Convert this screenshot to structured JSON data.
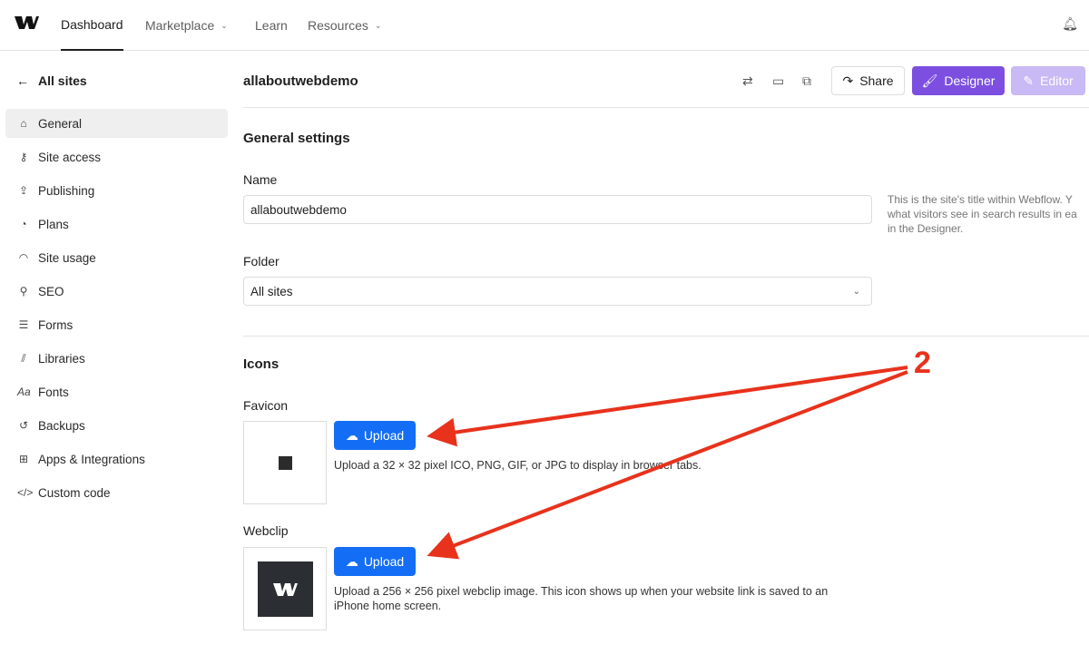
{
  "topnav": {
    "items": [
      {
        "label": "Dashboard",
        "active": true
      },
      {
        "label": "Marketplace",
        "dropdown": true
      },
      {
        "label": "Learn"
      },
      {
        "label": "Resources",
        "dropdown": true
      }
    ],
    "bell_icon": "bell-icon"
  },
  "sidebar": {
    "back_label": "All sites",
    "items": [
      {
        "label": "General",
        "icon": "home-icon",
        "selected": true
      },
      {
        "label": "Site access",
        "icon": "key-icon"
      },
      {
        "label": "Publishing",
        "icon": "publish-icon"
      },
      {
        "label": "Plans",
        "icon": "plans-icon"
      },
      {
        "label": "Site usage",
        "icon": "gauge-icon"
      },
      {
        "label": "SEO",
        "icon": "search-icon"
      },
      {
        "label": "Forms",
        "icon": "forms-icon"
      },
      {
        "label": "Libraries",
        "icon": "libraries-icon"
      },
      {
        "label": "Fonts",
        "icon": "fonts-icon"
      },
      {
        "label": "Backups",
        "icon": "backup-icon"
      },
      {
        "label": "Apps & Integrations",
        "icon": "apps-icon"
      },
      {
        "label": "Custom code",
        "icon": "code-icon"
      }
    ]
  },
  "header": {
    "site_name": "allaboutwebdemo",
    "share": "Share",
    "designer": "Designer",
    "editor": "Editor",
    "colors": {
      "designer": "#7c4fe0",
      "editor": "#c9b9f4"
    }
  },
  "general": {
    "title": "General settings",
    "name_label": "Name",
    "name_value": "allaboutwebdemo",
    "name_help": [
      "This is the site's title within Webflow. Y",
      "what visitors see in search results in ea",
      "in the Designer."
    ],
    "folder_label": "Folder",
    "folder_value": "All sites"
  },
  "icons": {
    "title": "Icons",
    "favicon_label": "Favicon",
    "upload": "Upload",
    "favicon_desc": "Upload a 32 × 32 pixel ICO, PNG, GIF, or JPG to display in browser tabs.",
    "webclip_label": "Webclip",
    "webclip_desc": [
      "Upload a 256 × 256 pixel webclip image. This icon shows up when your website link is saved to an",
      "iPhone home screen."
    ],
    "accent": "#146ef5"
  },
  "annotation": {
    "label": "2",
    "color": "#e8321c"
  }
}
